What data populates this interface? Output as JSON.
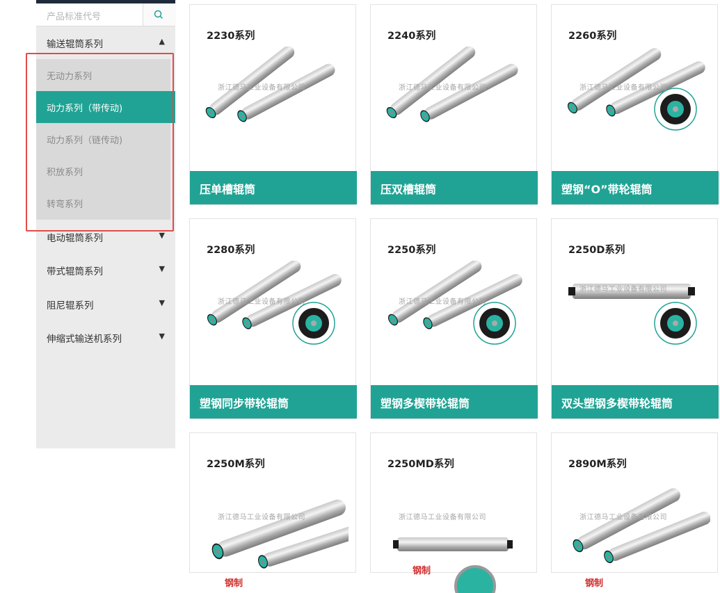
{
  "sidebar": {
    "search_placeholder": "产品标准代号",
    "categories": [
      {
        "label": "输送辊筒系列",
        "arrow": "▲"
      },
      {
        "label": "电动辊筒系列",
        "arrow": "▼"
      },
      {
        "label": "带式辊筒系列",
        "arrow": "▼"
      },
      {
        "label": "阻尼辊系列",
        "arrow": "▼"
      },
      {
        "label": "伸缩式输送机系列",
        "arrow": "▼"
      }
    ],
    "subitems": [
      {
        "label": "无动力系列",
        "active": false
      },
      {
        "label": "动力系列（带传动)",
        "active": true
      },
      {
        "label": "动力系列（链传动)",
        "active": false
      },
      {
        "label": "积放系列",
        "active": false
      },
      {
        "label": "转弯系列",
        "active": false
      }
    ]
  },
  "colors": {
    "accent": "#20a394",
    "highlight": "#e14b49"
  },
  "products": [
    {
      "series": "2230系列",
      "name": "压单槽辊筒",
      "watermark": "浙江德马工业设备有限公司"
    },
    {
      "series": "2240系列",
      "name": "压双槽辊筒",
      "watermark": "浙江德马工业设备有限公司"
    },
    {
      "series": "2260系列",
      "name": "塑钢“O”带轮辊筒",
      "watermark": "浙江德马工业设备有限公司"
    },
    {
      "series": "2280系列",
      "name": "塑钢同步带轮辊筒",
      "watermark": "浙江德马工业设备有限公司"
    },
    {
      "series": "2250系列",
      "name": "塑钢多楔带轮辊筒",
      "watermark": "浙江德马工业设备有限公司"
    },
    {
      "series": "2250D系列",
      "name": "双头塑钢多楔带轮辊筒",
      "watermark": "浙江德马工业设备有限公司"
    },
    {
      "series": "2250M系列",
      "name": "",
      "watermark": "浙江德马工业设备有限公司",
      "tag": "钢制"
    },
    {
      "series": "2250MD系列",
      "name": "",
      "watermark": "浙江德马工业设备有限公司",
      "tag": "钢制"
    },
    {
      "series": "2890M系列",
      "name": "",
      "watermark": "浙江德马工业设备有限公司",
      "tag": "钢制"
    }
  ]
}
